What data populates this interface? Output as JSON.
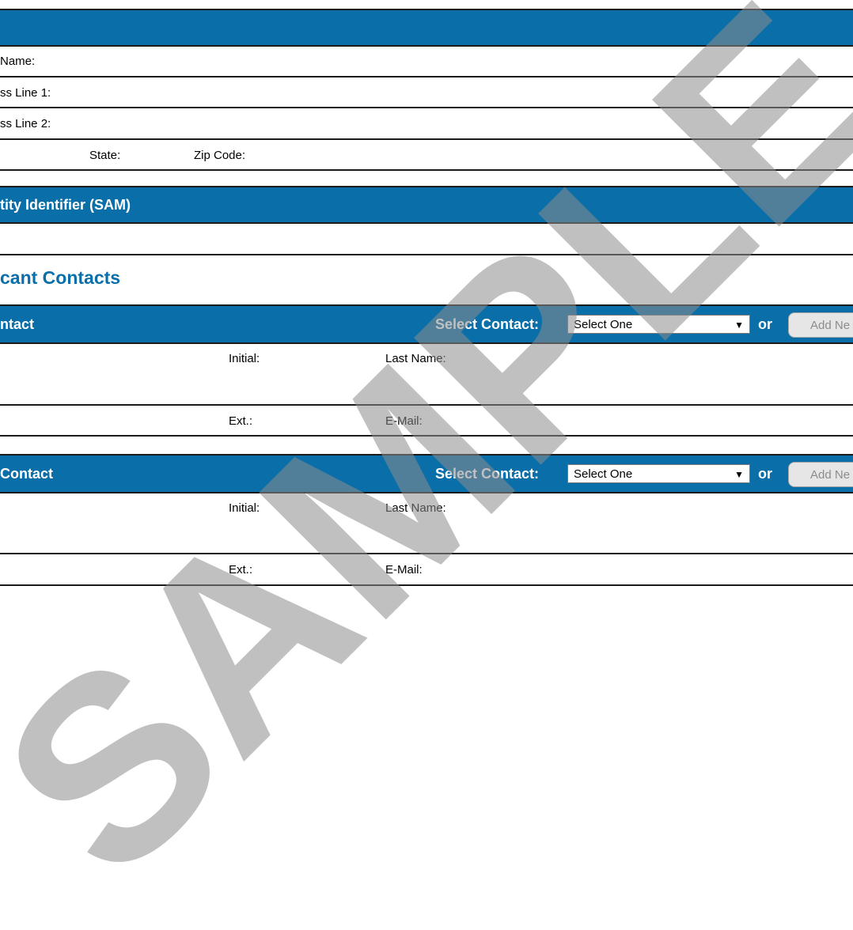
{
  "address_section": {
    "name_label": "Name:",
    "address_line1_label": "ss Line 1:",
    "address_line2_label": "ss Line 2:",
    "state_label": "State:",
    "zip_label": "Zip Code:"
  },
  "sam_section": {
    "title": "tity Identifier (SAM)"
  },
  "contacts_heading": "cant Contacts",
  "contacts": [
    {
      "title": "ntact",
      "select_label": "Select Contact:",
      "select_value": "Select One",
      "or_text": "or",
      "add_button": "Add Ne",
      "initial_label": "Initial:",
      "last_name_label": "Last Name:",
      "ext_label": "Ext.:",
      "email_label": "E-Mail:"
    },
    {
      "title": "Contact",
      "select_label": "Select Contact:",
      "select_value": "Select One",
      "or_text": "or",
      "add_button": "Add Ne",
      "initial_label": "Initial:",
      "last_name_label": "Last Name:",
      "ext_label": "Ext.:",
      "email_label": "E-Mail:"
    }
  ],
  "watermark": "SAMPLE",
  "icons": {
    "dropdown": "caret-down-icon"
  },
  "colors": {
    "header_band": "#0a6ea8",
    "heading_text": "#0a6ea8",
    "watermark": "#8c8c8c"
  }
}
